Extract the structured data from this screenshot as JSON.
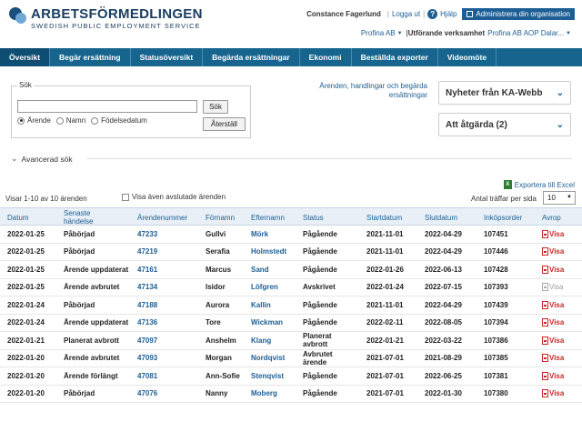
{
  "logo": {
    "name": "ARBETSFÖRMEDLINGEN",
    "subtitle": "SWEDISH PUBLIC EMPLOYMENT SERVICE"
  },
  "topbar": {
    "user": "Constance Fagerlund",
    "logout": "Logga ut",
    "help": "Hjälp",
    "admin": "Administrera din organisation"
  },
  "org": {
    "company": "Profina AB",
    "label": "Utförande verksamhet",
    "value": "Profina AB AOP Dalar..."
  },
  "nav": [
    "Översikt",
    "Begär ersättning",
    "Statusöversikt",
    "Begärda ersättningar",
    "Ekonomi",
    "Beställda exporter",
    "Videomöte"
  ],
  "search": {
    "legend": "Sök",
    "search_button": "Sök",
    "reset_button": "Återställ",
    "options": [
      "Ärende",
      "Namn",
      "Födelsedatum"
    ],
    "selected": "Ärende"
  },
  "help_text": "Ärenden, handlingar och begärda ersättningar",
  "panels": {
    "news": "Nyheter från KA-Webb",
    "todo": "Att åtgärda (2)"
  },
  "advanced_search": "Avancerad sök",
  "export": "Exportera till Excel",
  "list": {
    "showing": "Visar 1-10 av 10 ärenden",
    "show_closed": "Visa även avslutade ärenden",
    "per_page_label": "Antal träffar per sida",
    "per_page": "10"
  },
  "table": {
    "headers": [
      "Datum",
      "Senaste händelse",
      "Ärendenummer",
      "Förnamn",
      "Efternamn",
      "Status",
      "Startdatum",
      "Slutdatum",
      "Inköpsorder",
      "Avrop"
    ],
    "rows": [
      {
        "datum": "2022-01-25",
        "handelse": "Påbörjad",
        "nr": "47233",
        "fornamn": "Gullvi",
        "efternamn": "Mörk",
        "status": "Pågående",
        "start": "2021-11-01",
        "slut": "2022-04-29",
        "order": "107451",
        "avrop": "Visa",
        "avrop_active": true
      },
      {
        "datum": "2022-01-25",
        "handelse": "Påbörjad",
        "nr": "47219",
        "fornamn": "Serafia",
        "efternamn": "Holmstedt",
        "status": "Pågående",
        "start": "2021-11-01",
        "slut": "2022-04-29",
        "order": "107446",
        "avrop": "Visa",
        "avrop_active": true
      },
      {
        "datum": "2022-01-25",
        "handelse": "Ärende uppdaterat",
        "nr": "47161",
        "fornamn": "Marcus",
        "efternamn": "Sand",
        "status": "Pågående",
        "start": "2022-01-26",
        "slut": "2022-06-13",
        "order": "107428",
        "avrop": "Visa",
        "avrop_active": true
      },
      {
        "datum": "2022-01-25",
        "handelse": "Ärende avbrutet",
        "nr": "47134",
        "fornamn": "Isidor",
        "efternamn": "Löfgren",
        "status": "Avskrivet",
        "start": "2022-01-24",
        "slut": "2022-07-15",
        "order": "107393",
        "avrop": "Visa",
        "avrop_active": false
      },
      {
        "datum": "2022-01-24",
        "handelse": "Påbörjad",
        "nr": "47188",
        "fornamn": "Aurora",
        "efternamn": "Kallin",
        "status": "Pågående",
        "start": "2021-11-01",
        "slut": "2022-04-29",
        "order": "107439",
        "avrop": "Visa",
        "avrop_active": true
      },
      {
        "datum": "2022-01-24",
        "handelse": "Ärende uppdaterat",
        "nr": "47136",
        "fornamn": "Tore",
        "efternamn": "Wickman",
        "status": "Pågående",
        "start": "2022-02-11",
        "slut": "2022-08-05",
        "order": "107394",
        "avrop": "Visa",
        "avrop_active": true
      },
      {
        "datum": "2022-01-21",
        "handelse": "Planerat avbrott",
        "nr": "47097",
        "fornamn": "Anshelm",
        "efternamn": "Klang",
        "status": "Planerat avbrott",
        "start": "2022-01-21",
        "slut": "2022-03-22",
        "order": "107386",
        "avrop": "Visa",
        "avrop_active": true
      },
      {
        "datum": "2022-01-20",
        "handelse": "Ärende avbrutet",
        "nr": "47093",
        "fornamn": "Morgan",
        "efternamn": "Nordqvist",
        "status": "Avbrutet ärende",
        "start": "2021-07-01",
        "slut": "2021-08-29",
        "order": "107385",
        "avrop": "Visa",
        "avrop_active": true
      },
      {
        "datum": "2022-01-20",
        "handelse": "Ärende förlängt",
        "nr": "47081",
        "fornamn": "Ann-Sofie",
        "efternamn": "Stenqvist",
        "status": "Pågående",
        "start": "2021-07-01",
        "slut": "2022-06-25",
        "order": "107381",
        "avrop": "Visa",
        "avrop_active": true
      },
      {
        "datum": "2022-01-20",
        "handelse": "Påbörjad",
        "nr": "47076",
        "fornamn": "Nanny",
        "efternamn": "Moberg",
        "status": "Pågående",
        "start": "2021-07-01",
        "slut": "2022-01-30",
        "order": "107380",
        "avrop": "Visa",
        "avrop_active": true
      }
    ]
  }
}
